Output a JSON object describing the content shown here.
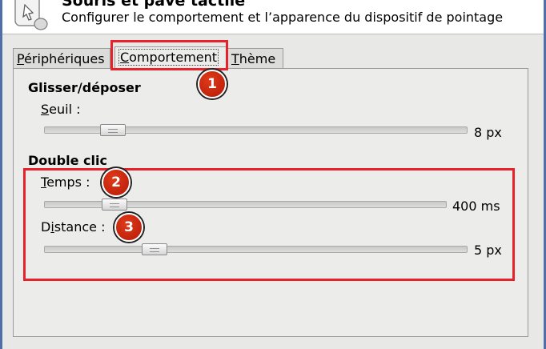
{
  "header": {
    "title": "Souris et pavé tactile",
    "subtitle": "Configurer le comportement et l’apparence du dispositif de pointage",
    "icon": "mouse-icon"
  },
  "tabs": [
    {
      "label": "Périphériques",
      "mnemonic": "P",
      "rest": "ériphériques",
      "active": false
    },
    {
      "label": "Comportement",
      "mnemonic": "C",
      "rest": "omportement",
      "active": true
    },
    {
      "label": "Thème",
      "mnemonic": "T",
      "rest": "hème",
      "active": false
    }
  ],
  "drag_drop": {
    "title": "Glisser/déposer",
    "threshold": {
      "label": "Seuil :",
      "mnemonic": "S",
      "rest": "euil :",
      "value": "8 px",
      "level": 0.07
    }
  },
  "double_click": {
    "title": "Double clic",
    "time": {
      "label": "Temps :",
      "mnemonic": "T",
      "rest": "emps :",
      "value": "400 ms",
      "level": 0.12
    },
    "distance": {
      "label": "Distance :",
      "mnemonic": "D",
      "pre": "D",
      "mn2": "i",
      "rest": "stance :",
      "value": "5 px",
      "level": 0.24
    }
  },
  "annotations": [
    "1",
    "2",
    "3"
  ],
  "colors": {
    "annotation": "#e8222a",
    "badge": "#c42208",
    "frame": "#4f6fa6"
  }
}
